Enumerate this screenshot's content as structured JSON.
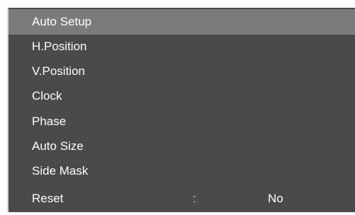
{
  "menu": {
    "items": [
      {
        "label": "Auto Setup",
        "selected": true
      },
      {
        "label": "H.Position"
      },
      {
        "label": "V.Position"
      },
      {
        "label": "Clock"
      },
      {
        "label": "Phase"
      },
      {
        "label": "Auto Size"
      },
      {
        "label": "Side Mask"
      },
      {
        "label": "Reset",
        "separator": ":",
        "value": "No"
      }
    ]
  },
  "colors": {
    "menu_background": "#4a4a4a",
    "selected_background": "#7b7b7b",
    "text": "#ffffff"
  }
}
